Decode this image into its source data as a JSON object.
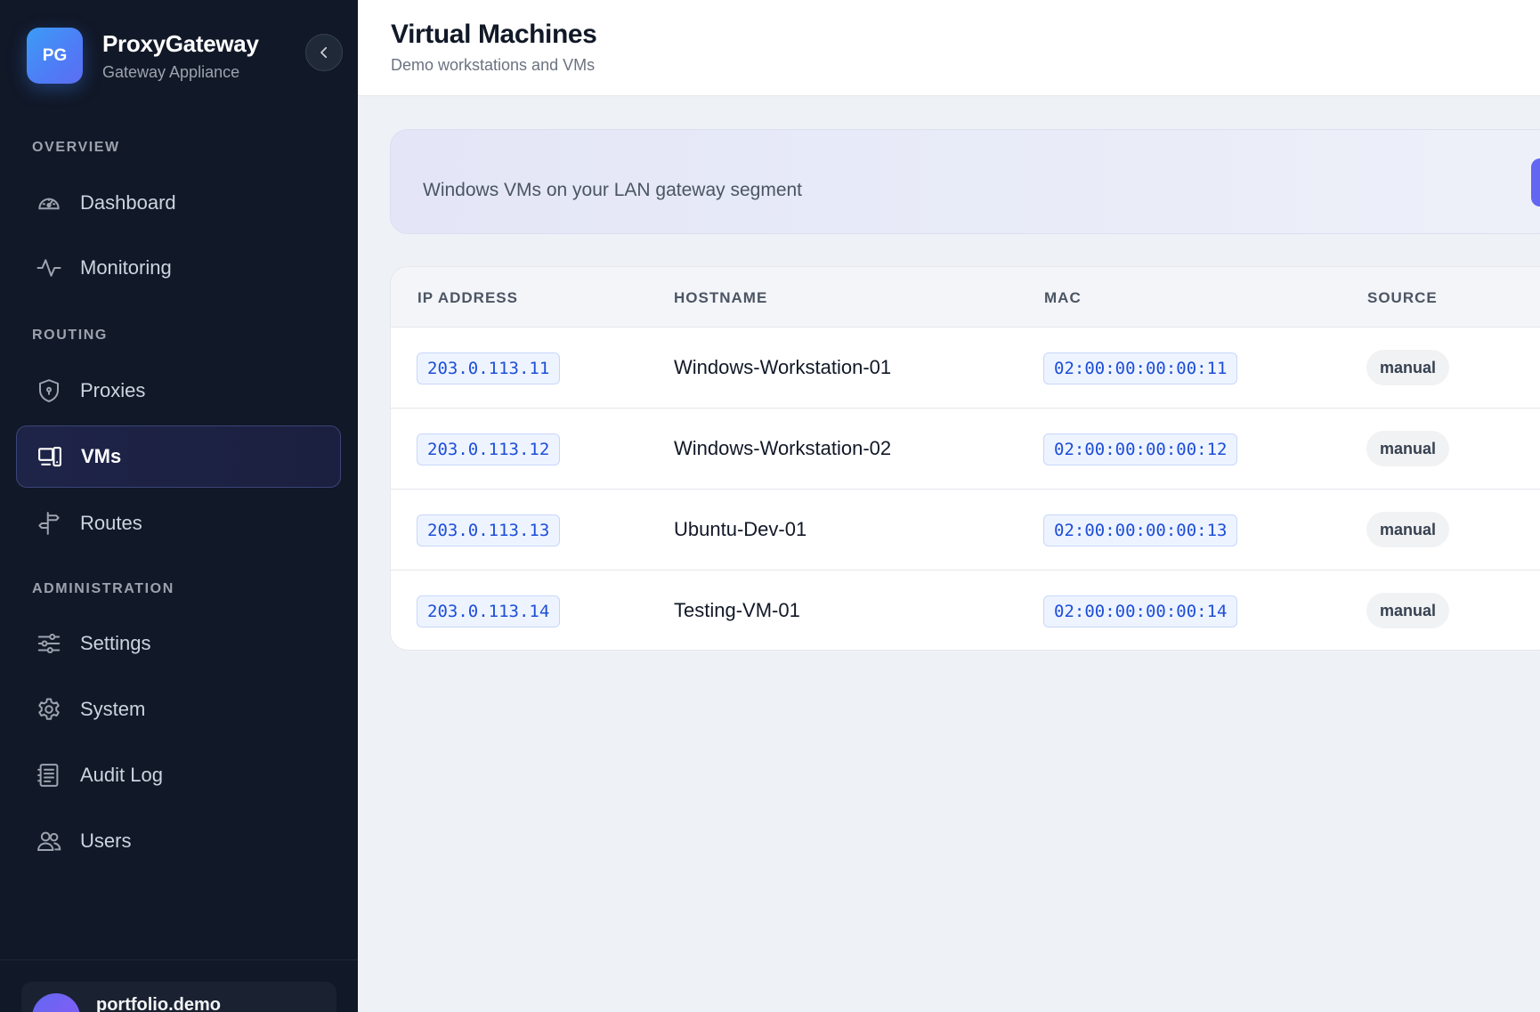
{
  "brand": {
    "logo_text": "PG",
    "title": "ProxyGateway",
    "subtitle": "Gateway Appliance"
  },
  "sidebar": {
    "sections": [
      {
        "label": "OVERVIEW"
      },
      {
        "label": "ROUTING"
      },
      {
        "label": "ADMINISTRATION"
      }
    ],
    "items": [
      {
        "label": "Dashboard",
        "icon": "gauge-icon"
      },
      {
        "label": "Monitoring",
        "icon": "activity-icon"
      },
      {
        "label": "Proxies",
        "icon": "shield-icon"
      },
      {
        "label": "VMs",
        "icon": "devices-icon",
        "active": true
      },
      {
        "label": "Routes",
        "icon": "signpost-icon"
      },
      {
        "label": "Settings",
        "icon": "sliders-icon"
      },
      {
        "label": "System",
        "icon": "gear-icon"
      },
      {
        "label": "Audit Log",
        "icon": "log-icon"
      },
      {
        "label": "Users",
        "icon": "users-icon"
      }
    ],
    "user": {
      "name": "portfolio.demo"
    }
  },
  "header": {
    "title": "Virtual Machines",
    "subtitle": "Demo workstations and VMs"
  },
  "banner": {
    "text": "Windows VMs on your LAN gateway segment"
  },
  "table": {
    "columns": [
      "IP ADDRESS",
      "HOSTNAME",
      "MAC",
      "SOURCE"
    ],
    "rows": [
      {
        "ip": "203.0.113.11",
        "hostname": "Windows-Workstation-01",
        "mac": "02:00:00:00:00:11",
        "source": "manual"
      },
      {
        "ip": "203.0.113.12",
        "hostname": "Windows-Workstation-02",
        "mac": "02:00:00:00:00:12",
        "source": "manual"
      },
      {
        "ip": "203.0.113.13",
        "hostname": "Ubuntu-Dev-01",
        "mac": "02:00:00:00:00:13",
        "source": "manual"
      },
      {
        "ip": "203.0.113.14",
        "hostname": "Testing-VM-01",
        "mac": "02:00:00:00:00:14",
        "source": "manual"
      }
    ]
  },
  "colors": {
    "sidebar_bg": "#111827",
    "accent": "#6366f1",
    "chip_text": "#1d4ed8"
  }
}
